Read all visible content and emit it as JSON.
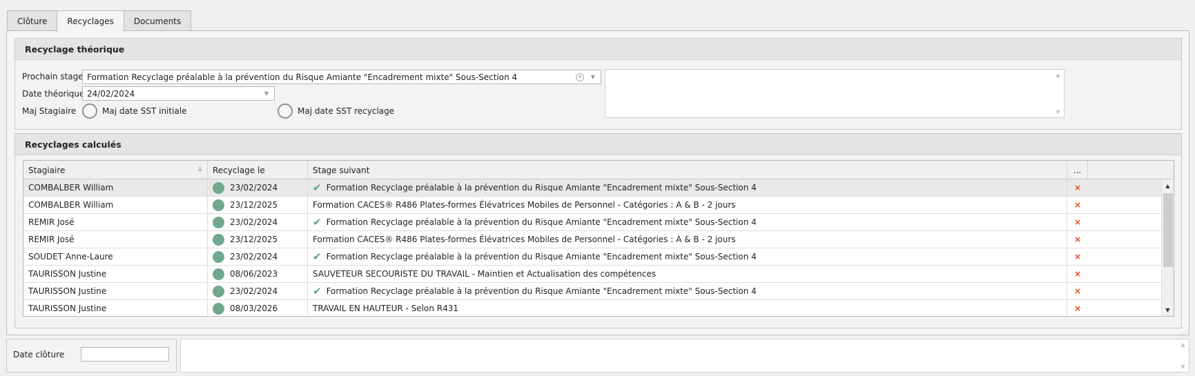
{
  "tabs": [
    {
      "label": "Clôture"
    },
    {
      "label": "Recyclages"
    },
    {
      "label": "Documents"
    }
  ],
  "active_tab": "Recyclages",
  "recyclage_theorique": {
    "title": "Recyclage théorique",
    "prochain_stage_label": "Prochain stage",
    "prochain_stage_value": "Formation Recyclage préalable à la prévention du Risque Amiante \"Encadrement mixte\" Sous-Section 4",
    "date_theorique_label": "Date théorique",
    "date_theorique_value": "24/02/2024",
    "maj_stagiaire_label": "Maj Stagiaire",
    "radio_sst_initiale": "Maj date SST initiale",
    "radio_sst_recyclage": "Maj date SST recyclage"
  },
  "recyclages_calcules": {
    "title": "Recyclages calculés",
    "columns": {
      "stagiaire": "Stagiaire",
      "recyclage_le": "Recyclage le",
      "stage_suivant": "Stage suivant",
      "more": "..."
    },
    "rows": [
      {
        "stagiaire": "COMBALBER William",
        "date": "23/02/2024",
        "checked": true,
        "stage": "Formation Recyclage préalable à la prévention du Risque Amiante \"Encadrement mixte\" Sous-Section 4",
        "delete": "×"
      },
      {
        "stagiaire": "COMBALBER William",
        "date": "23/12/2025",
        "checked": false,
        "stage": "Formation CACES® R486 Plates-formes Élévatrices Mobiles de Personnel - Catégories : A & B - 2 jours",
        "delete": "×"
      },
      {
        "stagiaire": "REMIR José",
        "date": "23/02/2024",
        "checked": true,
        "stage": "Formation Recyclage préalable à la prévention du Risque Amiante \"Encadrement mixte\" Sous-Section 4",
        "delete": "×"
      },
      {
        "stagiaire": "REMIR José",
        "date": "23/12/2025",
        "checked": false,
        "stage": "Formation CACES® R486 Plates-formes Élévatrices Mobiles de Personnel - Catégories : A & B - 2 jours",
        "delete": "×"
      },
      {
        "stagiaire": "SOUDET Anne-Laure",
        "date": "23/02/2024",
        "checked": true,
        "stage": "Formation Recyclage préalable à la prévention du Risque Amiante \"Encadrement mixte\" Sous-Section 4",
        "delete": "×"
      },
      {
        "stagiaire": "TAURISSON Justine",
        "date": "08/06/2023",
        "checked": false,
        "stage": "SAUVETEUR SECOURISTE DU TRAVAIL - Maintien et Actualisation des compétences",
        "delete": "×"
      },
      {
        "stagiaire": "TAURISSON Justine",
        "date": "23/02/2024",
        "checked": true,
        "stage": "Formation Recyclage préalable à la prévention du Risque Amiante \"Encadrement mixte\" Sous-Section 4",
        "delete": "×"
      },
      {
        "stagiaire": "TAURISSON Justine",
        "date": "08/03/2026",
        "checked": false,
        "stage": "TRAVAIL EN HAUTEUR - Selon R431",
        "delete": "×"
      }
    ]
  },
  "date_cloture": {
    "label": "Date clôture",
    "value": ""
  },
  "colors": {
    "status_dot": "#6fa88e",
    "check": "#5aa27a",
    "delete": "#e04a20"
  },
  "icons": {
    "check": "✔",
    "clear": "✕",
    "dropdown": "▼",
    "sort": "⥥",
    "scroll_up": "▲",
    "scroll_down": "▼"
  }
}
